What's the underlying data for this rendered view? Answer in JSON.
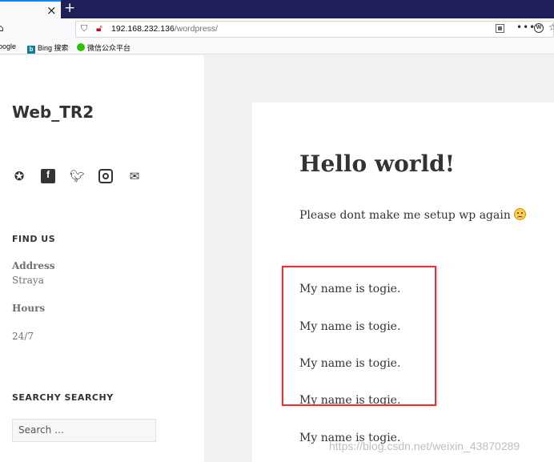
{
  "browser": {
    "tab_close_glyph": "×",
    "new_tab_glyph": "+",
    "url_host": "192.168.232.136",
    "url_path": "/wordpress/",
    "bookmarks": [
      "oogle",
      "Bing 搜索",
      "微信公众平台"
    ]
  },
  "site": {
    "title": "Web_TR2",
    "social_icons": [
      "wordpress-icon",
      "facebook-icon",
      "twitter-icon",
      "instagram-icon",
      "mail-icon"
    ]
  },
  "sidebar": {
    "find_us_title": "FIND US",
    "address_label": "Address",
    "address_value": "Straya",
    "hours_label": "Hours",
    "hours_value": "24/7",
    "search_title": "SEARCHY SEARCHY",
    "search_placeholder": "Search …"
  },
  "post": {
    "title": "Hello world!",
    "intro": "Please dont make me setup wp again",
    "lines": [
      "My name is togie.",
      "My name is togie.",
      "My name is togie.",
      "My name is togie.",
      "My name is togie."
    ]
  },
  "annotation": {
    "color": "#d9383a"
  },
  "watermark": "https://blog.csdn.net/weixin_43870289"
}
